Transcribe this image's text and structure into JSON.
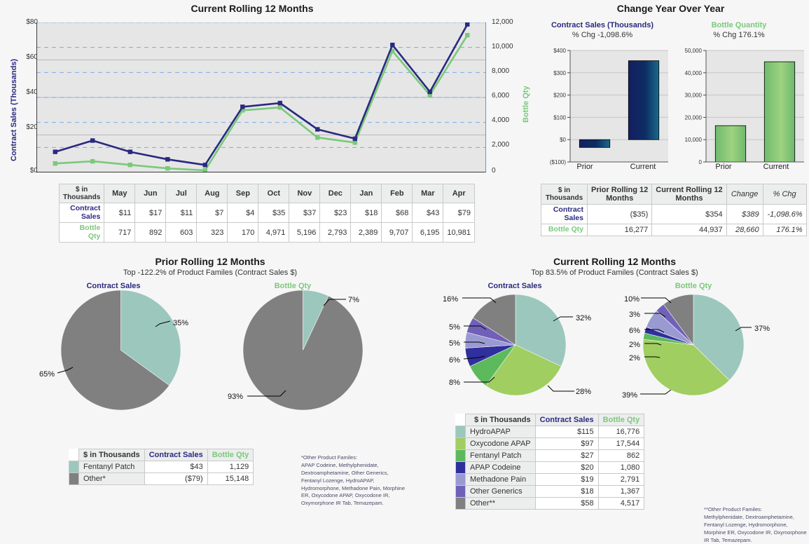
{
  "colors": {
    "series_blue": "#2a2a80",
    "series_green": "#7ac97a",
    "pie_teal": "#9cc7bd",
    "pie_gray": "#808080",
    "pie_lightgreen": "#a0ce61",
    "pie_green": "#5cba5c",
    "pie_navy": "#2f2f9e",
    "pie_periwinkle": "#9a9ad2",
    "pie_purple": "#7060b8",
    "plot_bg": "#e6e6e6",
    "negative_text": "#8a2020"
  },
  "line_chart": {
    "title": "Current Rolling 12 Months",
    "y_left_label": "Contract Sales (Thousands)",
    "y_right_label": "Bottle Qty",
    "y_left_ticks": [
      "$80",
      "$60",
      "$40",
      "$20",
      "$0"
    ],
    "y_right_ticks": [
      "12,000",
      "10,000",
      "8,000",
      "6,000",
      "4,000",
      "2,000",
      "0"
    ]
  },
  "chart_data": [
    {
      "type": "line",
      "title": "Current Rolling 12 Months",
      "xlabel": "",
      "ylabel": "Contract Sales (Thousands)",
      "y2label": "Bottle Qty",
      "ylim": [
        0,
        80
      ],
      "y2lim": [
        0,
        12000
      ],
      "grid": true,
      "categories": [
        "May",
        "Jun",
        "Jul",
        "Aug",
        "Sep",
        "Oct",
        "Nov",
        "Dec",
        "Jan",
        "Feb",
        "Mar",
        "Apr"
      ],
      "series": [
        {
          "name": "Contract Sales",
          "axis": "left",
          "color": "#2a2a80",
          "values": [
            11,
            17,
            11,
            7,
            4,
            35,
            37,
            23,
            18,
            68,
            43,
            79
          ]
        },
        {
          "name": "Bottle Qty",
          "axis": "right",
          "color": "#7ac97a",
          "values": [
            717,
            892,
            603,
            323,
            170,
            4971,
            5196,
            2793,
            2389,
            9707,
            6195,
            10981
          ]
        }
      ]
    },
    {
      "type": "bar",
      "title": "Contract Sales (Thousands)",
      "subtitle": "% Chg -1,098.6%",
      "categories": [
        "Prior",
        "Current"
      ],
      "values": [
        -35,
        354
      ],
      "ylim": [
        -100,
        400
      ],
      "ytick_labels": [
        "$400",
        "$300",
        "$200",
        "$100",
        "$0",
        "($100)"
      ],
      "color": "#1b2f7a"
    },
    {
      "type": "bar",
      "title": "Bottle Quantity",
      "subtitle": "% Chg 176.1%",
      "categories": [
        "Prior",
        "Current"
      ],
      "values": [
        16277,
        44937
      ],
      "ylim": [
        0,
        50000
      ],
      "ytick_labels": [
        "50,000",
        "40,000",
        "30,000",
        "20,000",
        "10,000",
        "0"
      ],
      "color": "#7cc47c"
    },
    {
      "type": "pie",
      "title": "Prior Rolling 12 Months",
      "subtitle": "Top -122.2% of Product Familes (Contract Sales $)",
      "caption": "Contract Sales",
      "labels": [
        "Fentanyl Patch",
        "Other*"
      ],
      "values": [
        35,
        65
      ],
      "display_labels": [
        "35%",
        "65%"
      ],
      "colors": [
        "#9cc7bd",
        "#808080"
      ]
    },
    {
      "type": "pie",
      "title": "Prior Rolling 12 Months",
      "caption": "Bottle Qty",
      "labels": [
        "Fentanyl Patch",
        "Other*"
      ],
      "values": [
        7,
        93
      ],
      "display_labels": [
        "7%",
        "93%"
      ],
      "colors": [
        "#9cc7bd",
        "#808080"
      ]
    },
    {
      "type": "pie",
      "title": "Current Rolling 12 Months",
      "subtitle": "Top 83.5% of Product Familes (Contract Sales $)",
      "caption": "Contract Sales",
      "labels": [
        "HydroAPAP",
        "Oxycodone APAP",
        "Fentanyl Patch",
        "APAP Codeine",
        "Methadone Pain",
        "Other Generics",
        "Other**"
      ],
      "values": [
        32,
        28,
        8,
        6,
        5,
        5,
        16
      ],
      "display_labels": [
        "32%",
        "28%",
        "8%",
        "6%",
        "5%",
        "5%",
        "16%"
      ],
      "colors": [
        "#9cc7bd",
        "#a0ce61",
        "#5cba5c",
        "#2f2f9e",
        "#9a9ad2",
        "#7060b8",
        "#808080"
      ]
    },
    {
      "type": "pie",
      "title": "Current Rolling 12 Months",
      "caption": "Bottle Qty",
      "labels": [
        "HydroAPAP",
        "Oxycodone APAP",
        "Fentanyl Patch",
        "APAP Codeine",
        "Methadone Pain",
        "Other Generics",
        "Other**"
      ],
      "values": [
        37,
        39,
        2,
        2,
        6,
        3,
        10
      ],
      "display_labels": [
        "37%",
        "39%",
        "2%",
        "2%",
        "6%",
        "3%",
        "10%"
      ],
      "colors": [
        "#9cc7bd",
        "#a0ce61",
        "#5cba5c",
        "#2f2f9e",
        "#9a9ad2",
        "#7060b8",
        "#808080"
      ]
    }
  ],
  "monthly_table": {
    "corner_line1": "$ in",
    "corner_line2": "Thousands",
    "months": [
      "May",
      "Jun",
      "Jul",
      "Aug",
      "Sep",
      "Oct",
      "Nov",
      "Dec",
      "Jan",
      "Feb",
      "Mar",
      "Apr"
    ],
    "rows": [
      {
        "label_line1": "Contract",
        "label_line2": "Sales",
        "style": "blue",
        "values": [
          "$11",
          "$17",
          "$11",
          "$7",
          "$4",
          "$35",
          "$37",
          "$23",
          "$18",
          "$68",
          "$43",
          "$79"
        ]
      },
      {
        "label_line1": "Bottle",
        "label_line2": "Qty",
        "style": "green",
        "values": [
          "717",
          "892",
          "603",
          "323",
          "170",
          "4,971",
          "5,196",
          "2,793",
          "2,389",
          "9,707",
          "6,195",
          "10,981"
        ]
      }
    ]
  },
  "yoy": {
    "title": "Change Year Over Year",
    "left": {
      "title": "Contract Sales (Thousands)",
      "subtitle": "% Chg -1,098.6%",
      "cat_prior": "Prior",
      "cat_current": "Current",
      "ticks": [
        "$400",
        "$300",
        "$200",
        "$100",
        "$0",
        "($100)"
      ]
    },
    "right": {
      "title": "Bottle Quantity",
      "subtitle": "% Chg 176.1%",
      "cat_prior": "Prior",
      "cat_current": "Current",
      "ticks": [
        "50,000",
        "40,000",
        "30,000",
        "20,000",
        "10,000",
        "0"
      ]
    }
  },
  "yoy_table": {
    "corner_line1": "$ in",
    "corner_line2": "Thousands",
    "headers": [
      "Prior Rolling 12 Months",
      "Current Rolling 12 Months",
      "Change",
      "% Chg"
    ],
    "header_lines": [
      [
        "Prior Rolling 12",
        "Months"
      ],
      [
        "Current Rolling 12",
        "Months"
      ],
      [
        "Change",
        ""
      ],
      [
        "% Chg",
        ""
      ]
    ],
    "rows": [
      {
        "label_line1": "Contract",
        "label_line2": "Sales",
        "style": "blue",
        "prior": "($35)",
        "current": "$354",
        "change": "$389",
        "pct": "-1,098.6%",
        "pct_negative": true
      },
      {
        "label_line1": "Bottle Qty",
        "label_line2": "",
        "style": "green",
        "prior": "16,277",
        "current": "44,937",
        "change": "28,660",
        "pct": "176.1%",
        "pct_negative": false
      }
    ]
  },
  "prior_section": {
    "title": "Prior Rolling 12 Months",
    "subtitle": "Top -122.2% of Product Familes (Contract Sales $)",
    "cap_contract": "Contract Sales",
    "cap_bottle": "Bottle Qty",
    "pie_contract_labels": [
      "35%",
      "65%"
    ],
    "pie_bottle_labels": [
      "7%",
      "93%"
    ]
  },
  "prior_legend": {
    "corner": "$ in Thousands",
    "col_contract": "Contract Sales",
    "col_bottle": "Bottle Qty",
    "rows": [
      {
        "color": "#9cc7bd",
        "name": "Fentanyl Patch",
        "contract": "$43",
        "bottle": "1,129"
      },
      {
        "color": "#808080",
        "name": "Other*",
        "contract": "($79)",
        "bottle": "15,148"
      }
    ]
  },
  "prior_footnote": "*Other Product Familes:\nAPAP Codeine, Methylphenidate,\nDextroamphetamine, Other Generics,\nFentanyl Lozenge, HydroAPAP,\nHydromorphone, Methadone Pain, Morphine\nER, Oxycodone APAP, Oxycodone IR,\nOxymorphone IR Tab, Temazepam.",
  "current_section": {
    "title": "Current Rolling 12 Months",
    "subtitle": "Top 83.5% of Product Familes (Contract Sales $)",
    "cap_contract": "Contract Sales",
    "cap_bottle": "Bottle Qty",
    "pie_contract_labels": [
      "16%",
      "5%",
      "5%",
      "6%",
      "8%",
      "28%",
      "32%"
    ],
    "pie_bottle_labels": [
      "10%",
      "3%",
      "6%",
      "2%",
      "2%",
      "39%",
      "37%"
    ]
  },
  "current_legend": {
    "corner": "$ in Thousands",
    "col_contract": "Contract Sales",
    "col_bottle": "Bottle Qty",
    "rows": [
      {
        "color": "#9cc7bd",
        "name": "HydroAPAP",
        "contract": "$115",
        "bottle": "16,776"
      },
      {
        "color": "#a0ce61",
        "name": "Oxycodone APAP",
        "contract": "$97",
        "bottle": "17,544"
      },
      {
        "color": "#5cba5c",
        "name": "Fentanyl Patch",
        "contract": "$27",
        "bottle": "862"
      },
      {
        "color": "#2f2f9e",
        "name": "APAP Codeine",
        "contract": "$20",
        "bottle": "1,080"
      },
      {
        "color": "#9a9ad2",
        "name": "Methadone Pain",
        "contract": "$19",
        "bottle": "2,791"
      },
      {
        "color": "#7060b8",
        "name": "Other Generics",
        "contract": "$18",
        "bottle": "1,367"
      },
      {
        "color": "#808080",
        "name": "Other**",
        "contract": "$58",
        "bottle": "4,517"
      }
    ]
  },
  "current_footnote": "**Other Product Familes:\nMethylphenidate, Dextroamphetamine,\nFentanyl Lozenge, Hydromorphone,\nMorphine ER, Oxycodone IR, Oxymorphone\nIR Tab, Temazepam."
}
